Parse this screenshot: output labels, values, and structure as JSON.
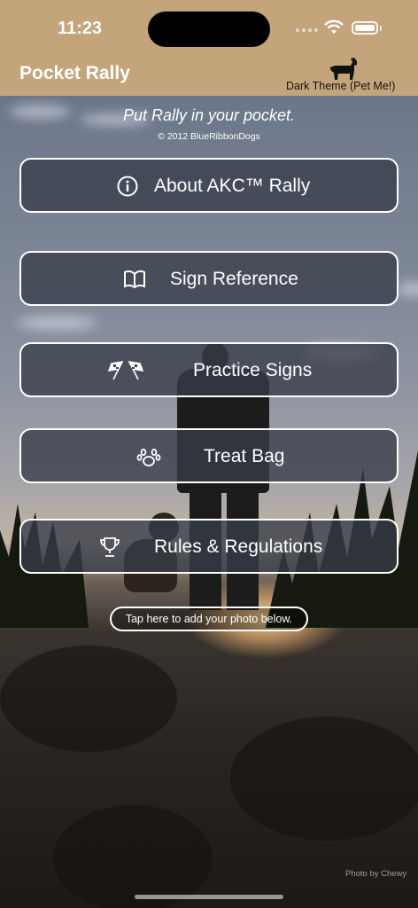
{
  "status_bar": {
    "time": "11:23"
  },
  "nav": {
    "title": "Pocket Rally",
    "theme_toggle_label": "Dark Theme (Pet Me!)",
    "theme_icon": "dog-icon"
  },
  "header": {
    "tagline": "Put Rally in your pocket.",
    "copyright": "© 2012 BlueRibbonDogs"
  },
  "menu": [
    {
      "label": "About AKC™ Rally",
      "icon": "info-icon"
    },
    {
      "label": "Sign Reference",
      "icon": "book-icon"
    },
    {
      "label": "Practice Signs",
      "icon": "checkered-flags-icon"
    },
    {
      "label": "Treat Bag",
      "icon": "paw-icon"
    },
    {
      "label": "Rules & Regulations",
      "icon": "trophy-icon"
    }
  ],
  "photo_tap_label": "Tap here to add your photo below.",
  "photo_credit": "Photo by Chewy",
  "colors": {
    "nav_bar": "#c4a57b",
    "button_fill": "#373c48",
    "button_border": "#ffffff"
  }
}
